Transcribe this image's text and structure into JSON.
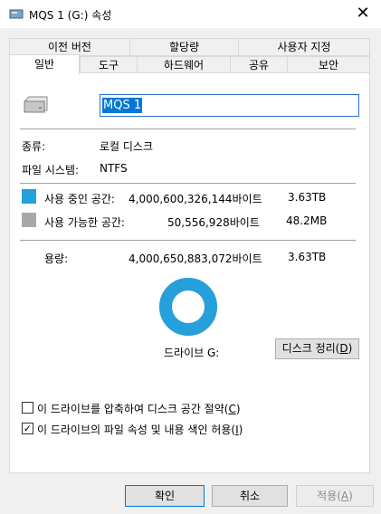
{
  "window": {
    "title": "MQS 1 (G:) 속성",
    "close_glyph": "✕"
  },
  "tabs_row1": [
    {
      "label": "이전 버전"
    },
    {
      "label": "할당량"
    },
    {
      "label": "사용자 지정"
    }
  ],
  "tabs_row2": [
    {
      "label": "일반"
    },
    {
      "label": "도구"
    },
    {
      "label": "하드웨어"
    },
    {
      "label": "공유"
    },
    {
      "label": "보안"
    }
  ],
  "general": {
    "volume_name": "MQS 1",
    "type_label": "종류:",
    "type_value": "로컬 디스크",
    "fs_label": "파일 시스템:",
    "fs_value": "NTFS",
    "used_label": "사용 중인 공간:",
    "used_bytes": "4,000,600,326,144바이트",
    "used_size": "3.63TB",
    "free_label": "사용 가능한 공간:",
    "free_bytes": "50,556,928바이트",
    "free_size": "48.2MB",
    "capacity_label": "용량:",
    "capacity_bytes": "4,000,650,883,072바이트",
    "capacity_size": "3.63TB",
    "used_fraction": 0.99999,
    "drive_label": "드라이브 G:",
    "cleanup_label": "디스크 정리(",
    "cleanup_key": "D",
    "cleanup_end": ")",
    "compress_label": "이 드라이브를 압축하여 디스크 공간 절약(",
    "compress_key": "C",
    "compress_end": ")",
    "compress_checked": false,
    "index_label": "이 드라이브의 파일 속성 및 내용 색인 허용(",
    "index_key": "I",
    "index_end": ")",
    "index_checked": true
  },
  "colors": {
    "used": "#26a0da",
    "free": "#a8a8a8"
  },
  "buttons": {
    "ok": "확인",
    "cancel": "취소",
    "apply": "적용(",
    "apply_key": "A",
    "apply_end": ")"
  }
}
